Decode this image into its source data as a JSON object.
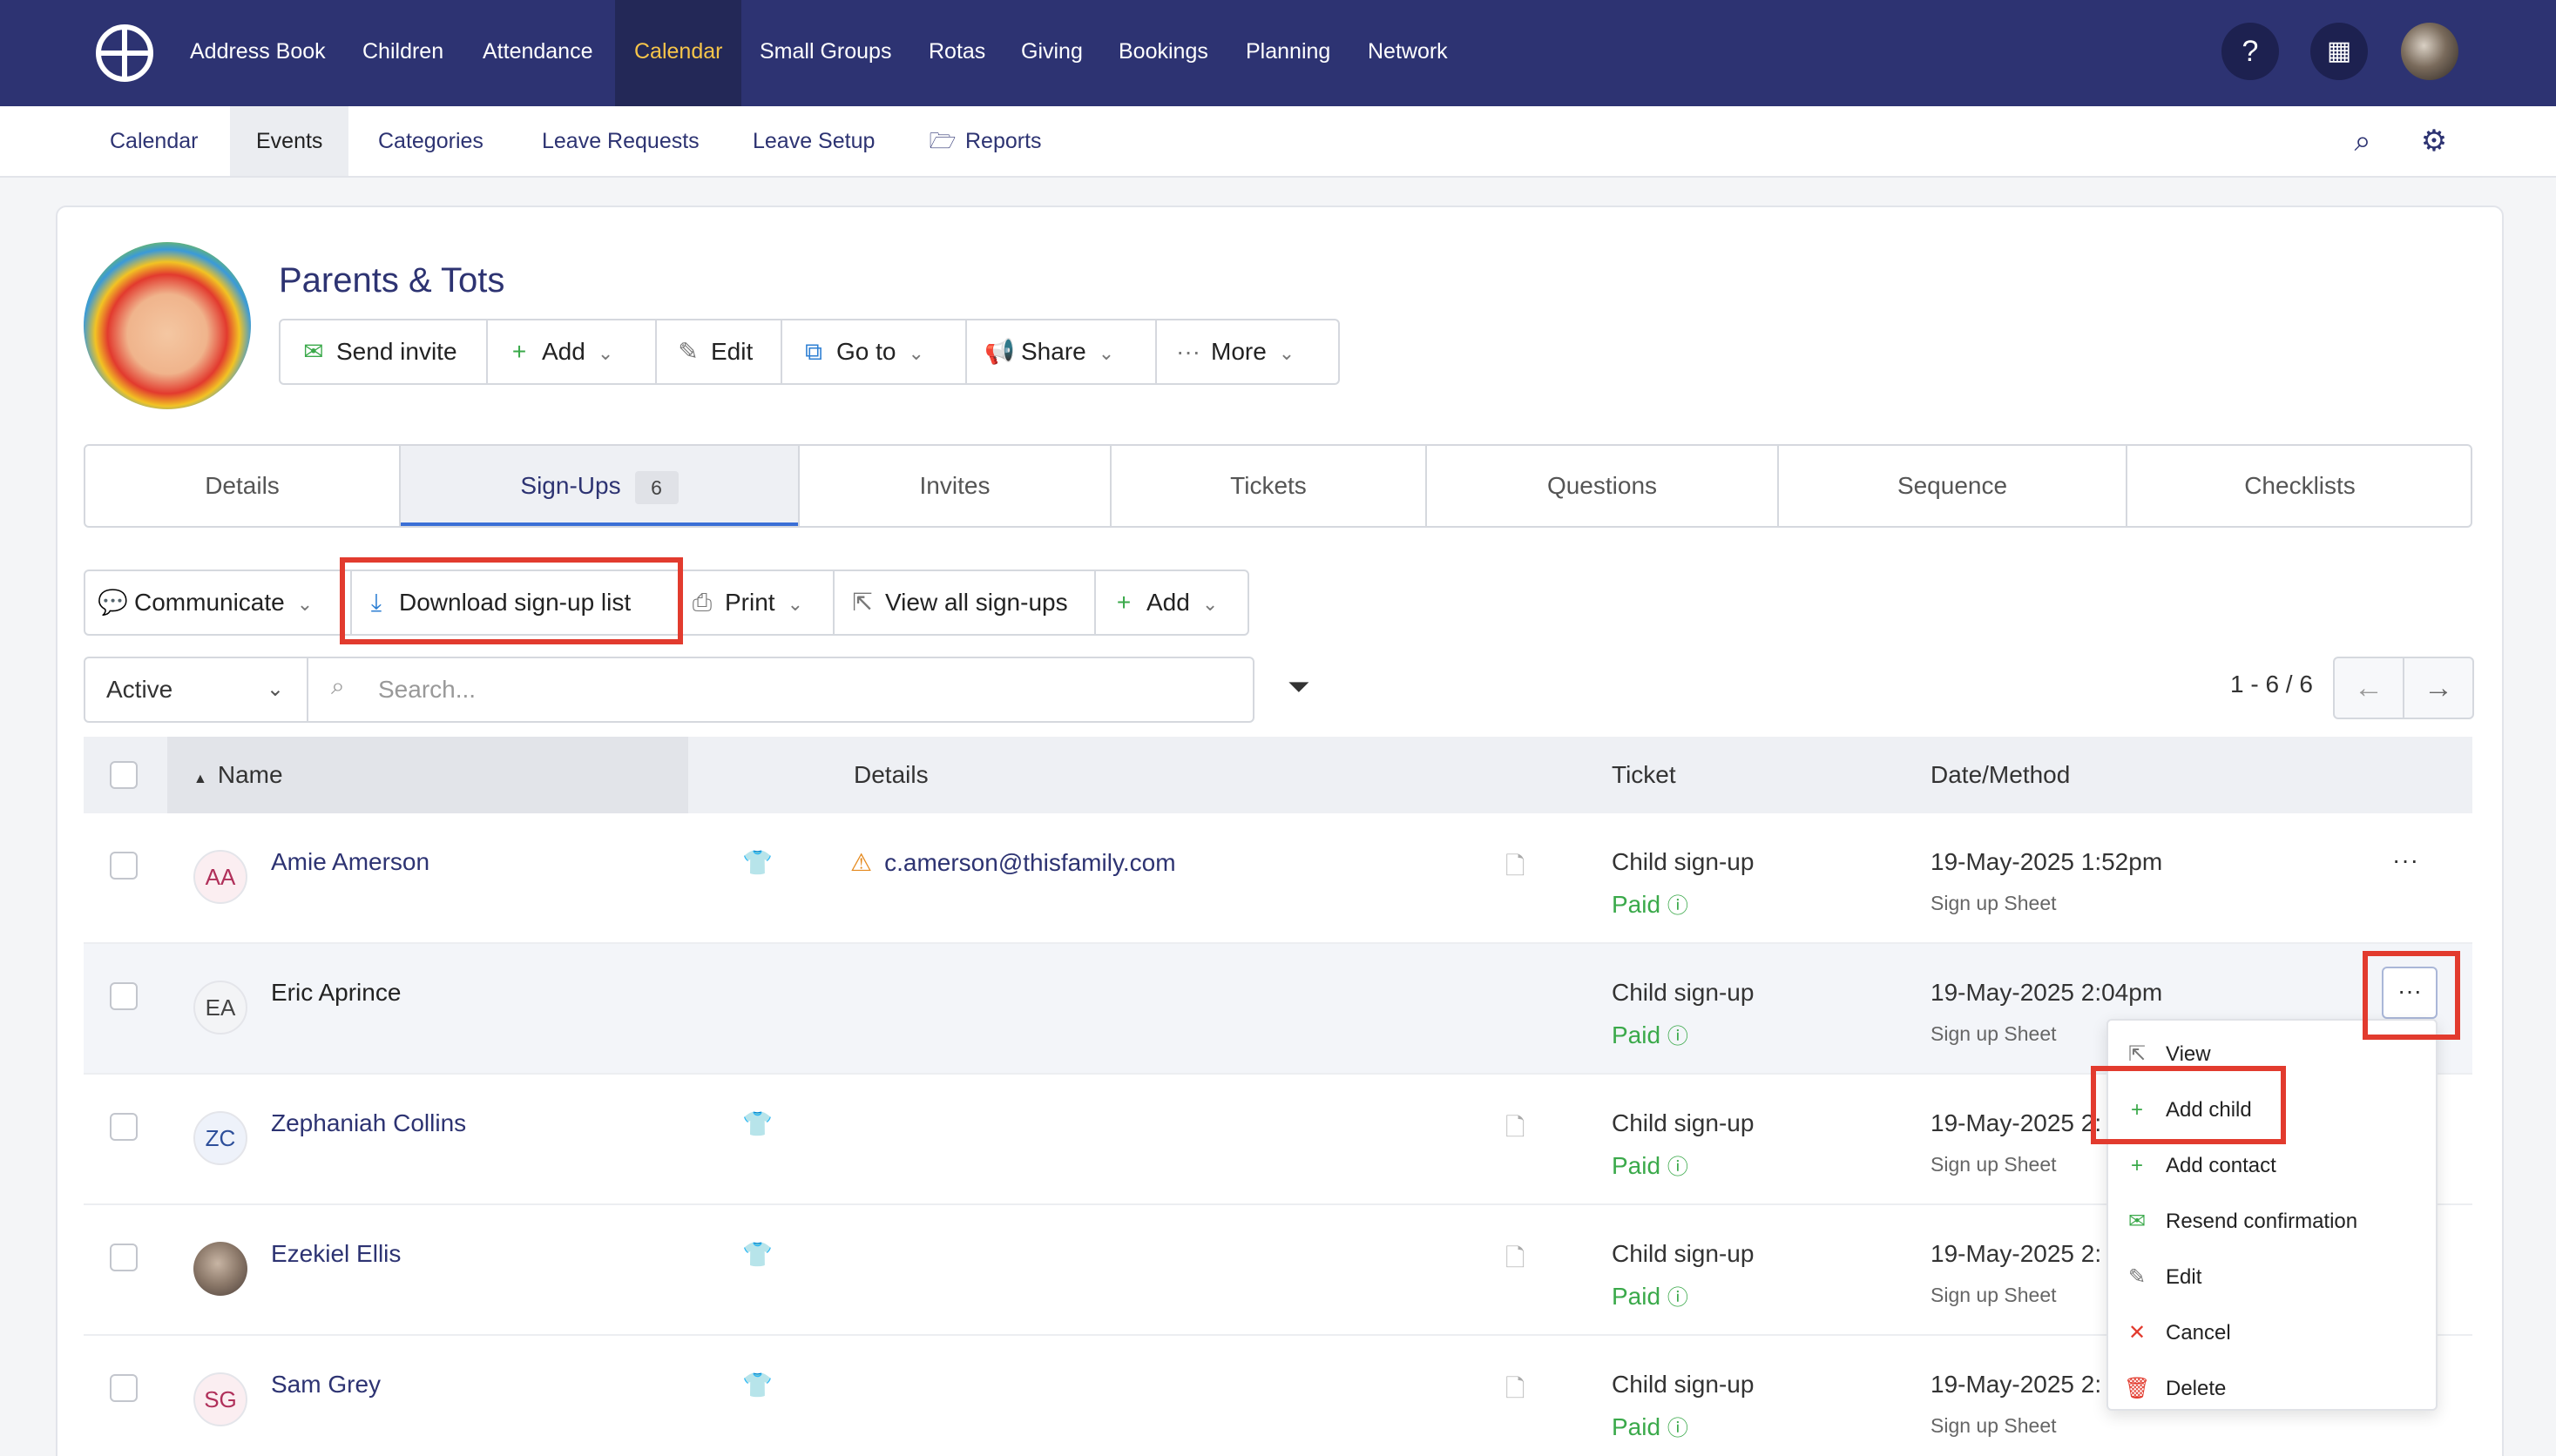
{
  "topnav": {
    "items": [
      "Address Book",
      "Children",
      "Attendance",
      "Calendar",
      "Small Groups",
      "Rotas",
      "Giving",
      "Bookings",
      "Planning",
      "Network"
    ],
    "active": "Calendar",
    "help_icon": "question-circle-icon",
    "org_icon": "building-icon"
  },
  "subnav": {
    "items": [
      "Calendar",
      "Events",
      "Categories",
      "Leave Requests",
      "Leave Setup",
      "Reports"
    ],
    "active": "Events",
    "reports_icon": "folder-open-icon",
    "search_icon": "search-icon",
    "settings_icon": "gear-icon"
  },
  "event": {
    "title": "Parents & Tots",
    "actions": [
      "Send invite",
      "Add",
      "Edit",
      "Go to",
      "Share",
      "More"
    ]
  },
  "tabs": {
    "items": [
      "Details",
      "Sign-Ups",
      "Invites",
      "Tickets",
      "Questions",
      "Sequence",
      "Checklists"
    ],
    "active": "Sign-Ups",
    "signups_count": "6"
  },
  "toolbar": {
    "items": [
      "Communicate",
      "Download sign-up list",
      "Print",
      "View all sign-ups",
      "Add"
    ]
  },
  "filter": {
    "status": "Active",
    "search_placeholder": "Search...",
    "filter_icon": "funnel-icon",
    "pager": "1 - 6 / 6"
  },
  "table": {
    "headers": [
      "Name",
      "Details",
      "Ticket",
      "Date/Method"
    ],
    "rows": [
      {
        "initials": "AA",
        "name": "Amie Amerson",
        "email": "c.amerson@thisfamily.com",
        "ticket": "Child sign-up",
        "status": "Paid",
        "date": "19-May-2025 1:52pm",
        "method": "Sign up Sheet"
      },
      {
        "initials": "EA",
        "name": "Eric Aprince",
        "email": "",
        "ticket": "Child sign-up",
        "status": "Paid",
        "date": "19-May-2025 2:04pm",
        "method": "Sign up Sheet"
      },
      {
        "initials": "ZC",
        "name": "Zephaniah Collins",
        "email": "",
        "ticket": "Child sign-up",
        "status": "Paid",
        "date": "19-May-2025 2:",
        "method": "Sign up Sheet"
      },
      {
        "initials": "",
        "name": "Ezekiel Ellis",
        "email": "",
        "ticket": "Child sign-up",
        "status": "Paid",
        "date": "19-May-2025 2:",
        "method": "Sign up Sheet"
      },
      {
        "initials": "SG",
        "name": "Sam Grey",
        "email": "",
        "ticket": "Child sign-up",
        "status": "Paid",
        "date": "19-May-2025 2:",
        "method": "Sign up Sheet"
      }
    ]
  },
  "context_menu": {
    "items": [
      "View",
      "Add child",
      "Add contact",
      "Resend confirmation",
      "Edit",
      "Cancel",
      "Delete"
    ]
  },
  "colors": {
    "nav_bg": "#2d3372",
    "nav_active": "#f6c54a",
    "accent_green": "#3aa94a",
    "highlight_red": "#e23b2e"
  }
}
